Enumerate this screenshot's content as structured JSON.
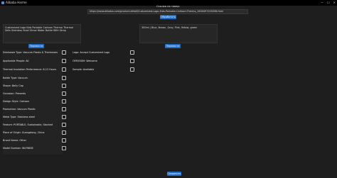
{
  "window": {
    "title": "Alibaba Harme",
    "controls": [
      "—",
      "☐",
      "✕"
    ]
  },
  "url_section": {
    "label": "Ссылка на товар:",
    "url_value": "https://www.alibaba.com/product-detail/Customized-Logo-Kids-Portable-Cartoon-Thermo_1600497205058.html",
    "submit_label": "Обработать"
  },
  "title_box": {
    "text": "Customized Logo Kids Portable Cartoon Thermo Thermal Sells Stainless Steel Straw Water Bottle With Strap",
    "button_label": "Перевести"
  },
  "colors_box": {
    "text": "300ml | Blue, Brown, Gray, Pink, Yellow, green",
    "button_label": "Перевести"
  },
  "left_properties": [
    {
      "label": "Drinkware Type: Vacuum Flasks & Thermoses"
    },
    {
      "label": "Applicable People: All"
    },
    {
      "label": "Thermal Insulation Performance: 8-12 Hours"
    },
    {
      "label": "Bottle Type: Vacuum"
    },
    {
      "label": "Shape: Belly Cap"
    },
    {
      "label": "Occasion: Presents"
    },
    {
      "label": "Design Style: Cartoon"
    },
    {
      "label": "Production: Vacuum Plastic"
    },
    {
      "label": "Metal Type: Stainless steel"
    },
    {
      "label": "Feature: PORTABLE, Sustainable, Stocked"
    },
    {
      "label": "Place of Origin: Guangdong, China"
    },
    {
      "label": "Brand Name: Other"
    },
    {
      "label": "Model Number: WLY9808"
    }
  ],
  "right_properties": [
    {
      "label": "Logo: Accept Customized Logo"
    },
    {
      "label": "OEM/ODM: Welcome"
    },
    {
      "label": "Sample: Available"
    }
  ],
  "footer": {
    "button_label": "Сохранить"
  },
  "colors": {
    "background": "#1e1e1e",
    "accent": "#1f6fc9",
    "titlebar": "#000000"
  }
}
